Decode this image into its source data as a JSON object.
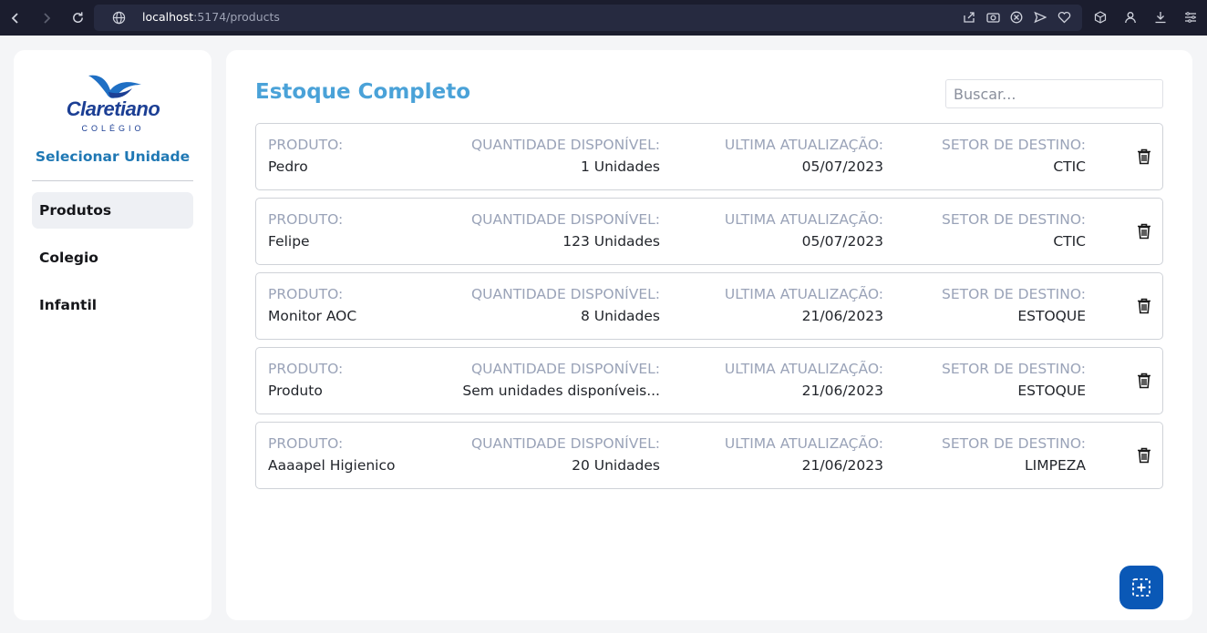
{
  "browser": {
    "url_host": "localhost",
    "url_path": ":5174/products"
  },
  "sidebar": {
    "logo_text": "Claretiano",
    "logo_sub": "COLÉGIO",
    "select_unit": "Selecionar Unidade",
    "items": [
      {
        "label": "Produtos",
        "active": true
      },
      {
        "label": "Colegio",
        "active": false
      },
      {
        "label": "Infantil",
        "active": false
      }
    ]
  },
  "main": {
    "title": "Estoque Completo",
    "search_placeholder": "Buscar...",
    "labels": {
      "product": "PRODUTO:",
      "quantity": "QUANTIDADE DISPONÍVEL:",
      "updated": "ULTIMA ATUALIZAÇÃO:",
      "sector": "SETOR DE DESTINO:"
    },
    "rows": [
      {
        "product": "Pedro",
        "quantity": "1 Unidades",
        "updated": "05/07/2023",
        "sector": "CTIC"
      },
      {
        "product": "Felipe",
        "quantity": "123 Unidades",
        "updated": "05/07/2023",
        "sector": "CTIC"
      },
      {
        "product": "Monitor AOC",
        "quantity": "8 Unidades",
        "updated": "21/06/2023",
        "sector": "ESTOQUE"
      },
      {
        "product": "Produto",
        "quantity": "Sem unidades disponíveis...",
        "updated": "21/06/2023",
        "sector": "ESTOQUE"
      },
      {
        "product": "Aaaapel Higienico",
        "quantity": "20 Unidades",
        "updated": "21/06/2023",
        "sector": "LIMPEZA"
      }
    ]
  },
  "colors": {
    "accent": "#4aa2d8",
    "select_unit": "#1f78b4",
    "fab": "#0a58b6",
    "logo": "#1c3f94"
  }
}
